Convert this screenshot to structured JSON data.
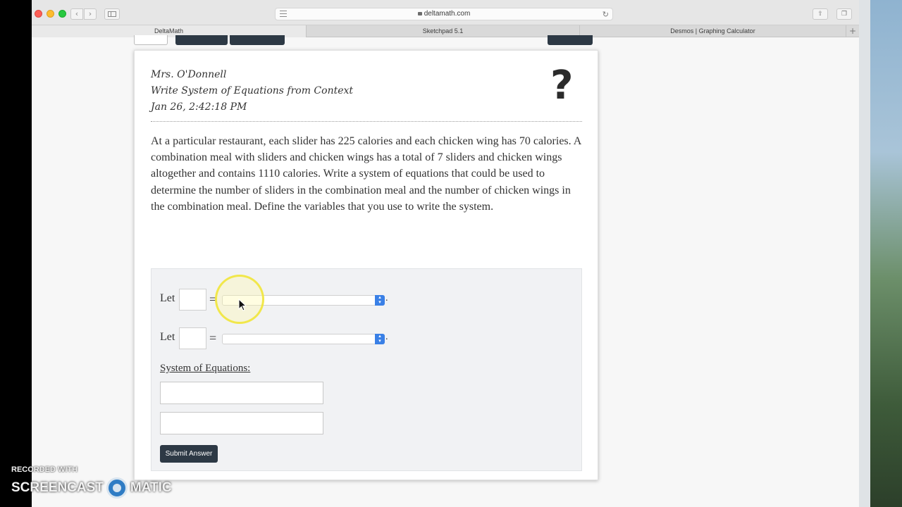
{
  "browser": {
    "url": "deltamath.com",
    "tabs": [
      "DeltaMath",
      "Sketchpad 5.1",
      "Desmos | Graphing Calculator"
    ]
  },
  "header": {
    "teacher": "Mrs. O'Donnell",
    "assignment": "Write System of Equations from Context",
    "timestamp": "Jan 26, 2:42:18 PM"
  },
  "help_icon": "?",
  "question": "At a particular restaurant, each slider has 225 calories and each chicken wing has 70 calories. A combination meal with sliders and chicken wings has a total of 7 sliders and chicken wings altogether and contains 1110 calories. Write a system of equations that could be used to determine the number of sliders in the combination meal and the number of chicken wings in the combination meal. Define the variables that you use to write the system.",
  "answer": {
    "let_label": "Let",
    "equals": "=",
    "period": ".",
    "system_label": "System of Equations:",
    "submit_label": "Submit Answer"
  },
  "watermark": {
    "line1": "RECORDED WITH",
    "left": "SCREENCAST",
    "right": "MATIC"
  },
  "colors": {
    "dark_button": "#2d3945",
    "select_arrow": "#3a80e6",
    "cursor_highlight": "#f0e63c"
  }
}
